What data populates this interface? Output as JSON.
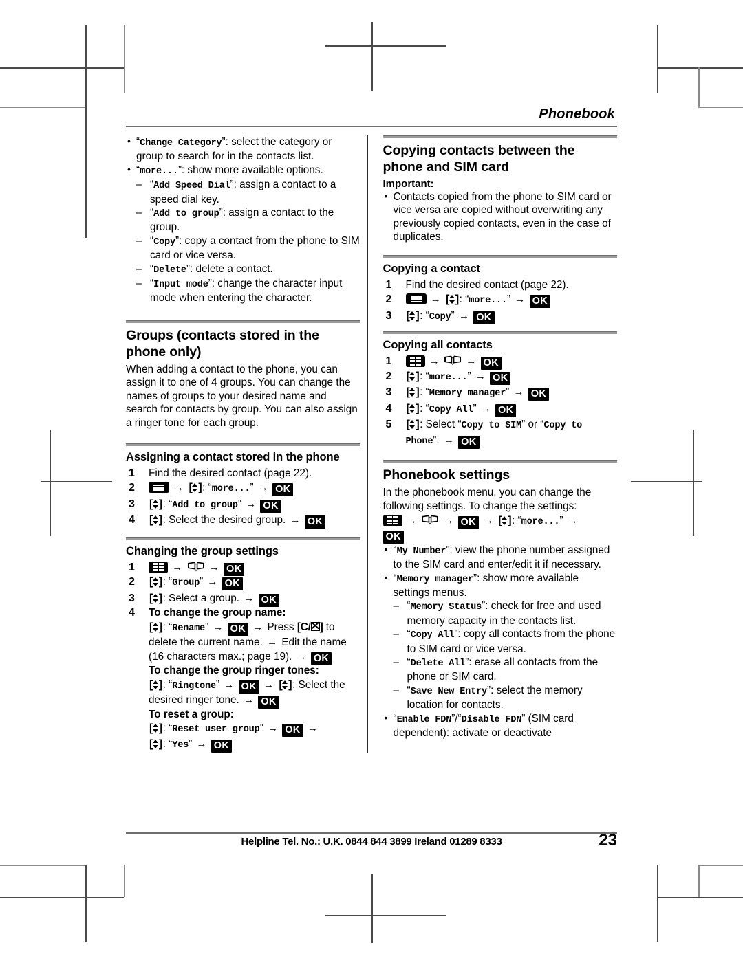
{
  "runninghead": "Phonebook",
  "left_column": {
    "top_bullets": [
      {
        "code": "Change Category",
        "text": ": select the category or group to search for in the contacts list."
      },
      {
        "code": "more...",
        "text": ": show more available options."
      }
    ],
    "top_dashes": [
      {
        "code": "Add Speed Dial",
        "text": ": assign a contact to a speed dial key."
      },
      {
        "code": "Add to group",
        "text": ": assign a contact to the group."
      },
      {
        "code": "Copy",
        "text": ": copy a contact from the phone to SIM card or vice versa."
      },
      {
        "code": "Delete",
        "text": ": delete a contact."
      },
      {
        "code": "Input mode",
        "text": ": change the character input mode when entering the character."
      }
    ],
    "groups_heading": "Groups (contacts stored in the phone only)",
    "groups_body": "When adding a contact to the phone, you can assign it to one of 4 groups. You can change the names of groups to your desired name and search for contacts by group. You can also assign a ringer tone for each group.",
    "assign_heading": "Assigning a contact stored in the phone",
    "assign_steps": {
      "s1": "Find the desired contact (page 22).",
      "s2_code": "more...",
      "s3_code": "Add to group",
      "s4_text": ": Select the desired group."
    },
    "changing_heading": "Changing the group settings",
    "changing_steps": {
      "s2_code": "Group",
      "s3_text": ": Select a group.",
      "s4_title": "To change the group name:",
      "s4_rename_code": "Rename",
      "s4_press": "Press",
      "s4_clear_tail": "to delete the current name.",
      "s4_edit": "Edit the name (16 characters max.; page 19).",
      "ringer_title": "To change the group ringer tones:",
      "ringer_code": "Ringtone",
      "ringer_select": ": Select the desired ringer tone.",
      "reset_title": "To reset a group:",
      "reset_code": "Reset user group",
      "reset_yes": "Yes"
    }
  },
  "right_column": {
    "copying_heading": "Copying contacts between the phone and SIM card",
    "important_label": "Important:",
    "important_bullet": "Contacts copied from the phone to SIM card or vice versa are copied without overwriting any previously copied contacts, even in the case of duplicates.",
    "copy_contact_heading": "Copying a contact",
    "copy_contact_steps": {
      "s1": "Find the desired contact (page 22).",
      "s2_code": "more...",
      "s3_code": "Copy"
    },
    "copy_all_heading": "Copying all contacts",
    "copy_all_steps": {
      "s2_code": "more...",
      "s3_code": "Memory manager",
      "s4_code": "Copy All",
      "s5_select": ": Select",
      "s5_code_a": "Copy to SIM",
      "s5_or": "or",
      "s5_code_b": "Copy to Phone",
      "s5_tail": "."
    },
    "settings_heading": "Phonebook settings",
    "settings_body": "In the phonebook menu, you can change the following settings. To change the settings:",
    "settings_path_code": "more...",
    "settings_bullets": [
      {
        "code": "My Number",
        "text": ": view the phone number assigned to the SIM card and enter/edit it if necessary."
      },
      {
        "code": "Memory manager",
        "text": ": show more available settings menus."
      }
    ],
    "settings_dashes": [
      {
        "code": "Memory Status",
        "text": ": check for free and used memory capacity in the contacts list."
      },
      {
        "code": "Copy All",
        "text": ": copy all contacts from the phone to SIM card or vice versa."
      },
      {
        "code": "Delete All",
        "text": ": erase all contacts from the phone or SIM card."
      },
      {
        "code": "Save New Entry",
        "text": ": select the memory location for contacts."
      }
    ],
    "fdn_bullet": {
      "code_a": "Enable FDN",
      "sep": "/",
      "code_b": "Disable FDN",
      "text": " (SIM card dependent): activate or deactivate"
    }
  },
  "keys": {
    "ok": "OK",
    "clear_label": "C/",
    "menu_icon": "menu-bars-key",
    "grid_icon": "main-menu-key",
    "book_icon": "phonebook-key",
    "nav_icon": "navigator-up-down-key",
    "arrow": "→"
  },
  "footer": {
    "helpline": "Helpline Tel. No.: U.K. 0844 844 3899 Ireland 01289 8333",
    "page_number": "23"
  }
}
